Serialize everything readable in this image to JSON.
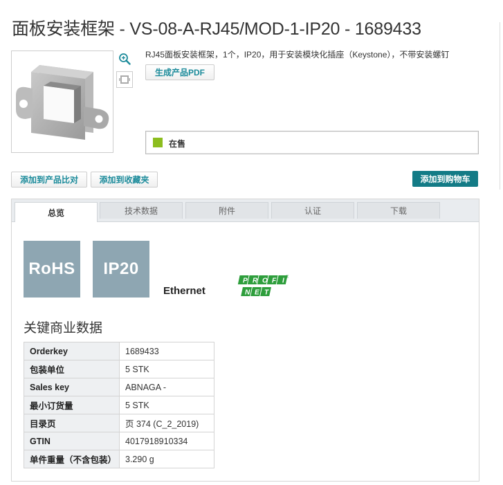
{
  "page": {
    "title": "面板安装框架 - VS-08-A-RJ45/MOD-1-IP20 - 1689433"
  },
  "product": {
    "description": "RJ45面板安装框架，1个，IP20，用于安装模块化插座（Keystone），不带安装螺钉",
    "pdf_button": "生成产品PDF",
    "status": "在售",
    "status_color": "#8cbd1e"
  },
  "actions": {
    "compare": "添加到产品比对",
    "favorites": "添加到收藏夹",
    "cart": "添加到购物车"
  },
  "tabs": [
    {
      "label": "总览",
      "active": true
    },
    {
      "label": "技术数据",
      "active": false
    },
    {
      "label": "附件",
      "active": false
    },
    {
      "label": "认证",
      "active": false
    },
    {
      "label": "下载",
      "active": false
    }
  ],
  "badges": {
    "rohs": "RoHS",
    "ip20": "IP20",
    "ethernet": "Ethernet",
    "profi": "PROFI",
    "net": "NET"
  },
  "key_data": {
    "title": "关键商业数据",
    "rows": [
      {
        "key": "Orderkey",
        "value": "1689433"
      },
      {
        "key": "包装单位",
        "value": "5 STK"
      },
      {
        "key": "Sales key",
        "value": "ABNAGA -"
      },
      {
        "key": "最小订货量",
        "value": "5 STK"
      },
      {
        "key": "目录页",
        "value": "页 374 (C_2_2019)"
      },
      {
        "key": "GTIN",
        "value": "4017918910334"
      },
      {
        "key": "单件重量（不含包装）",
        "value": "3.290 g"
      }
    ]
  },
  "colors": {
    "accent": "#137b86",
    "link": "#1a8a9a",
    "badge": "#8ea6b2",
    "profinet": "#2e9e3c"
  }
}
